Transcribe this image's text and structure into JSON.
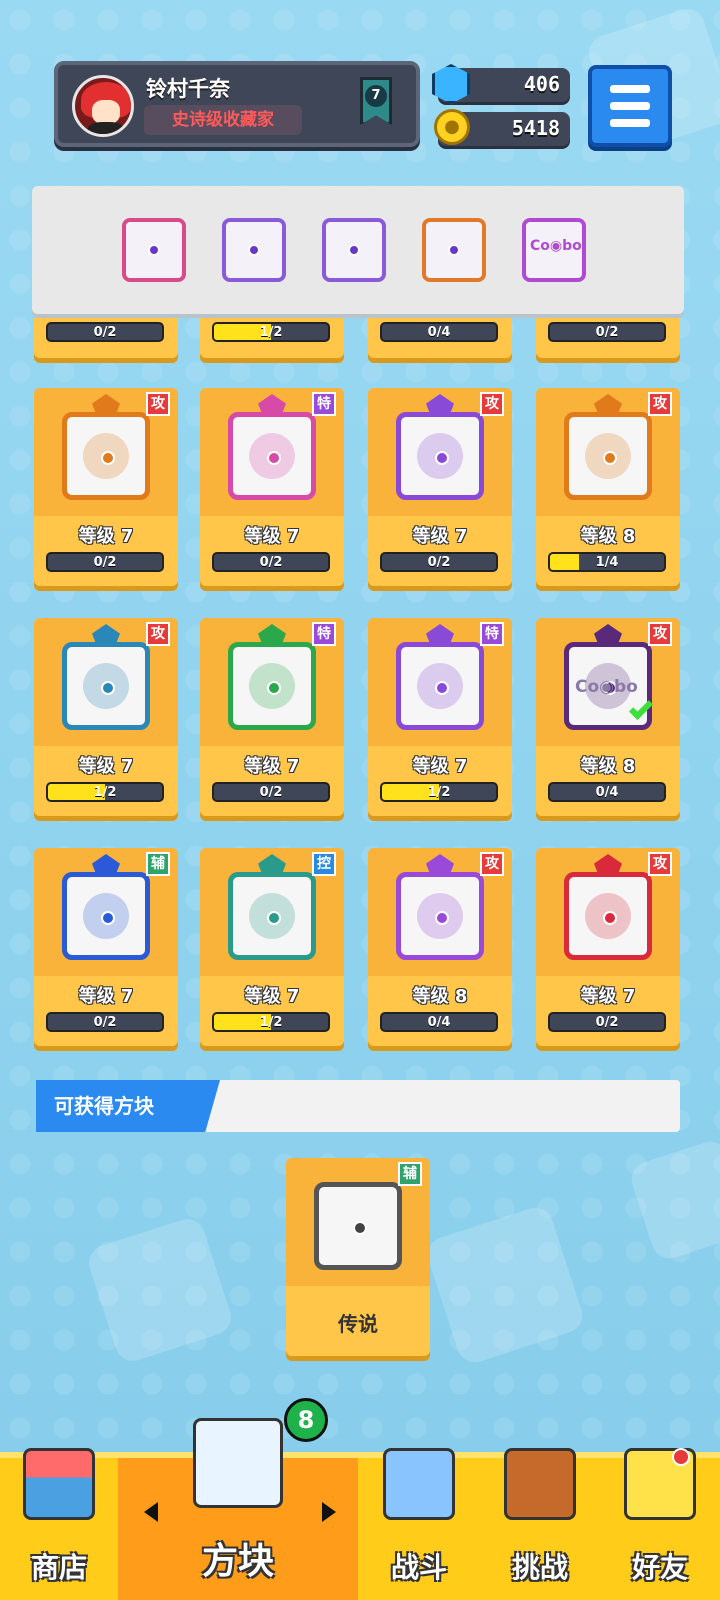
{
  "profile": {
    "name": "铃村千奈",
    "title": "史诗级收藏家",
    "rank": "7"
  },
  "currency": {
    "gems": "406",
    "coins": "5418",
    "gem_icon": "gem-icon",
    "coin_icon": "coin-icon"
  },
  "deck": {
    "slots": [
      {
        "icon": "rainbow-dice-icon",
        "color": "#9b5bd8"
      },
      {
        "icon": "purple-dragon-dice-icon",
        "color": "#8a5bd8"
      },
      {
        "icon": "purple-crack-dice-icon",
        "color": "#8a5bd8"
      },
      {
        "icon": "infinity-dice-icon",
        "color": "#e07a2a"
      },
      {
        "icon": "combo-dice-icon",
        "color": "#b04ad0",
        "text": "Co◉bo"
      }
    ]
  },
  "partial_row": [
    {
      "progress": "0/2",
      "fill": 0
    },
    {
      "progress": "1/2",
      "fill": 0.5
    },
    {
      "progress": "0/4",
      "fill": 0
    },
    {
      "progress": "0/2",
      "fill": 0
    }
  ],
  "cards": [
    {
      "tag": "攻",
      "tag_type": "atk",
      "level": "等级 7",
      "progress": "0/2",
      "fill": 0,
      "color": "#e07a1a",
      "icon": "sun-dice-icon"
    },
    {
      "tag": "特",
      "tag_type": "spc",
      "level": "等级 7",
      "progress": "0/2",
      "fill": 0,
      "color": "#d84aa8",
      "icon": "sword-dice-icon"
    },
    {
      "tag": "攻",
      "tag_type": "atk",
      "level": "等级 7",
      "progress": "0/2",
      "fill": 0,
      "color": "#8a4ad8",
      "icon": "atom-dice-icon"
    },
    {
      "tag": "攻",
      "tag_type": "atk",
      "level": "等级 8",
      "progress": "1/4",
      "fill": 0.25,
      "color": "#e07a1a",
      "icon": "gun-dice-icon"
    },
    {
      "tag": "攻",
      "tag_type": "atk",
      "level": "等级 7",
      "progress": "1/2",
      "fill": 0.5,
      "color": "#2a88b8",
      "icon": "vortex-dice-icon"
    },
    {
      "tag": "特",
      "tag_type": "spc",
      "level": "等级 7",
      "progress": "0/2",
      "fill": 0,
      "color": "#2aa84a",
      "icon": "wind-dice-icon"
    },
    {
      "tag": "特",
      "tag_type": "spc",
      "level": "等级 7",
      "progress": "1/2",
      "fill": 0.5,
      "color": "#8a4ad8",
      "icon": "swirl-dice-icon"
    },
    {
      "tag": "攻",
      "tag_type": "atk",
      "level": "等级 8",
      "progress": "0/4",
      "fill": 0,
      "color": "#5a2a7a",
      "icon": "combo-dice-icon",
      "combo": "Co◉bo",
      "equipped": true
    },
    {
      "tag": "辅",
      "tag_type": "sup",
      "level": "等级 7",
      "progress": "0/2",
      "fill": 0,
      "color": "#2a5ad8",
      "icon": "crescent-dice-icon"
    },
    {
      "tag": "控",
      "tag_type": "ctl",
      "level": "等级 7",
      "progress": "1/2",
      "fill": 0.5,
      "color": "#2a9a8a",
      "icon": "wave-dice-icon"
    },
    {
      "tag": "攻",
      "tag_type": "atk",
      "level": "等级 8",
      "progress": "0/4",
      "fill": 0,
      "color": "#9a4ad8",
      "icon": "star-dice-icon"
    },
    {
      "tag": "攻",
      "tag_type": "atk",
      "level": "等级 7",
      "progress": "0/2",
      "fill": 0,
      "color": "#d82a3a",
      "icon": "blackhole-dice-icon"
    }
  ],
  "available": {
    "label": "可获得方块",
    "card": {
      "tag": "辅",
      "rarity": "传说",
      "icon": "clock-dice-icon"
    }
  },
  "nav": {
    "items": [
      {
        "label": "商店",
        "icon": "shop-icon"
      },
      {
        "label": "方块",
        "icon": "dice-box-icon",
        "active": true,
        "badge": "8"
      },
      {
        "label": "战斗",
        "icon": "battle-icon"
      },
      {
        "label": "挑战",
        "icon": "challenge-icon"
      },
      {
        "label": "好友",
        "icon": "friends-icon"
      }
    ]
  }
}
